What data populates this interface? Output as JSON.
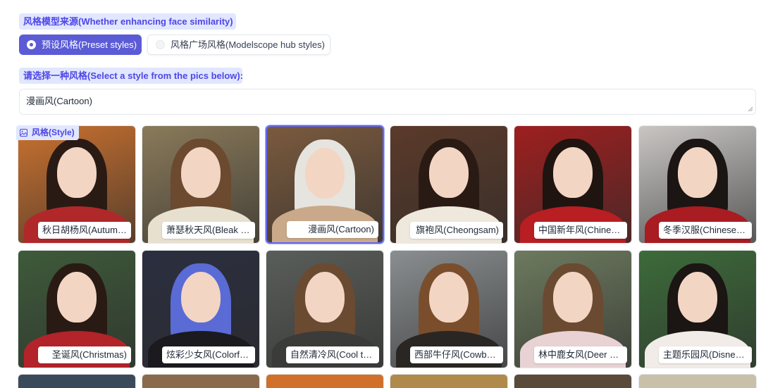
{
  "source_label": "风格模型来源(Whether enhancing face similarity)",
  "source_options": {
    "preset": "预设风格(Preset styles)",
    "hub": "风格广场风格(Modelscope hub styles)"
  },
  "select_label": "请选择一种风格(Select a style from the pics below):",
  "selected_style": "漫画风(Cartoon)",
  "gallery": {
    "label": "风格(Style)",
    "icon": "image-icon",
    "selected_index": 2,
    "items": [
      {
        "caption": "秋日胡杨风(Autumn...",
        "bg": "#c9712f",
        "hair": "#2a1a14",
        "body": "#b0282a"
      },
      {
        "caption": "萧瑟秋天风(Bleak a...",
        "bg": "#8a7a5a",
        "hair": "#6b4a30",
        "body": "#e8e0cf"
      },
      {
        "caption": "漫画风(Cartoon)",
        "bg": "#7a5a3e",
        "hair": "#e6e4df",
        "body": "#c9a98a"
      },
      {
        "caption": "旗袍风(Cheongsam)",
        "bg": "#5b3a2a",
        "hair": "#2a1a14",
        "body": "#efe8dc"
      },
      {
        "caption": "中国新年风(Chinese...",
        "bg": "#9e1f1f",
        "hair": "#1f1410",
        "body": "#b81e22"
      },
      {
        "caption": "冬季汉服(Chinese w...",
        "bg": "#c9c6c4",
        "hair": "#1b1513",
        "body": "#a81c22"
      },
      {
        "caption": "圣诞风(Christmas)",
        "bg": "#3e5a3a",
        "hair": "#2a1a14",
        "body": "#b3232a"
      },
      {
        "caption": "炫彩少女风(Colorful ...",
        "bg": "#2b2e3f",
        "hair": "#5a6bd6",
        "body": "#1a1a1f"
      },
      {
        "caption": "自然清冷风(Cool ton...",
        "bg": "#5a5e5a",
        "hair": "#6b4a32",
        "body": "#3b3b3a"
      },
      {
        "caption": "西部牛仔风(Cowboy...",
        "bg": "#8a8e90",
        "hair": "#7a4e2c",
        "body": "#2a2623"
      },
      {
        "caption": "林中鹿女风(Deer girl)",
        "bg": "#6d7a5e",
        "hair": "#6b4a32",
        "body": "#e8d2d4"
      },
      {
        "caption": "主题乐园风(Disneyl...",
        "bg": "#3d6b3a",
        "hair": "#1b1513",
        "body": "#f1ece8"
      }
    ],
    "partial_row_bgs": [
      "#3a4a5a",
      "#8a6a4a",
      "#d0702a",
      "#b08a4a",
      "#5a4a3a",
      "#c8c0a8"
    ]
  }
}
